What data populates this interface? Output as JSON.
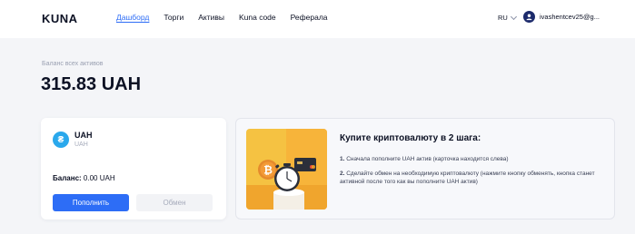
{
  "header": {
    "logo": "KUNA",
    "nav": [
      {
        "label": "Дашборд",
        "active": true
      },
      {
        "label": "Торги",
        "active": false
      },
      {
        "label": "Активы",
        "active": false
      },
      {
        "label": "Kuna code",
        "active": false
      },
      {
        "label": "Реферала",
        "active": false
      }
    ],
    "language": "RU",
    "user_email": "ivashentcev25@g..."
  },
  "balance": {
    "label": "Баланс всех активов",
    "value": "315.83 UAH"
  },
  "asset_card": {
    "symbol": "UAH",
    "name": "UAH",
    "coin_glyph": "₴",
    "balance_label": "Баланс:",
    "balance_value": "0.00 UAH",
    "deposit_button": "Пополнить",
    "exchange_button": "Обмен"
  },
  "info_card": {
    "title": "Купите криптовалюту в 2 шага:",
    "step1_num": "1.",
    "step1_text": "Сначала пополните UAH актив (карточка находится слева)",
    "step2_num": "2.",
    "step2_text": "Сделайте обмен на необходимую криптовалюту (нажмите кнопку обменять, кнопка станет активной после того как вы пополните UAH актив)"
  },
  "colors": {
    "accent": "#2d6df6",
    "text": "#0c1124",
    "muted": "#9aa0b2",
    "page_bg": "#f4f5f8",
    "coin": "#2aa8ec"
  }
}
